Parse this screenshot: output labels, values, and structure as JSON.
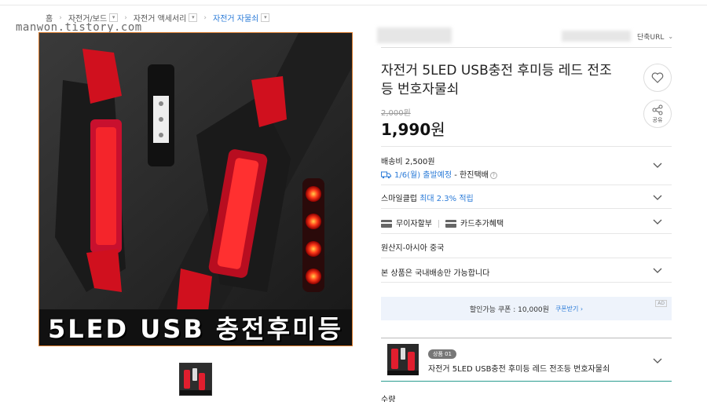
{
  "breadcrumb": {
    "home": "홈",
    "cat1": "자전거/보드",
    "cat2": "자전거 액세서리",
    "cat3": "자전거 자물쇠",
    "dropdown_icon": "chevron-down-small"
  },
  "watermark": "manwon.tistory.com",
  "image": {
    "banner_text": "5LED USB 충전후미등"
  },
  "header": {
    "short_url": "단축URL"
  },
  "product": {
    "title": "자전거 5LED USB충전 후미등 레드 전조등 번호자물쇠",
    "original_price": "2,000원",
    "price_number": "1,990",
    "price_unit": "원",
    "wish_icon": "heart-icon",
    "share_label": "공유"
  },
  "shipping": {
    "fee": "배송비 2,500원",
    "date": "1/6(월) 출발예정",
    "carrier": " - 한진택배",
    "help": "?"
  },
  "smileclub": {
    "label": "스마일클럽",
    "rate": "최대 2.3% 적립"
  },
  "benefits": {
    "installment": "무이자할부",
    "card": "카드추가혜택"
  },
  "origin": "원산지-아시아 중국",
  "domestic": "본 상품은 국내배송만 가능합니다",
  "coupon": {
    "text": "할인가능 쿠폰 : 10,000원",
    "link": "쿠폰받기 ›",
    "ad": "AD"
  },
  "option": {
    "badge": "상품 01",
    "name": "자전거 5LED USB충전 후미등 레드 전조등 번호자물쇠"
  },
  "quantity_label": "수량",
  "colors": {
    "accent_blue": "#2b7bd8",
    "image_border": "#d87a2c",
    "option_border": "#2a9d8f"
  }
}
